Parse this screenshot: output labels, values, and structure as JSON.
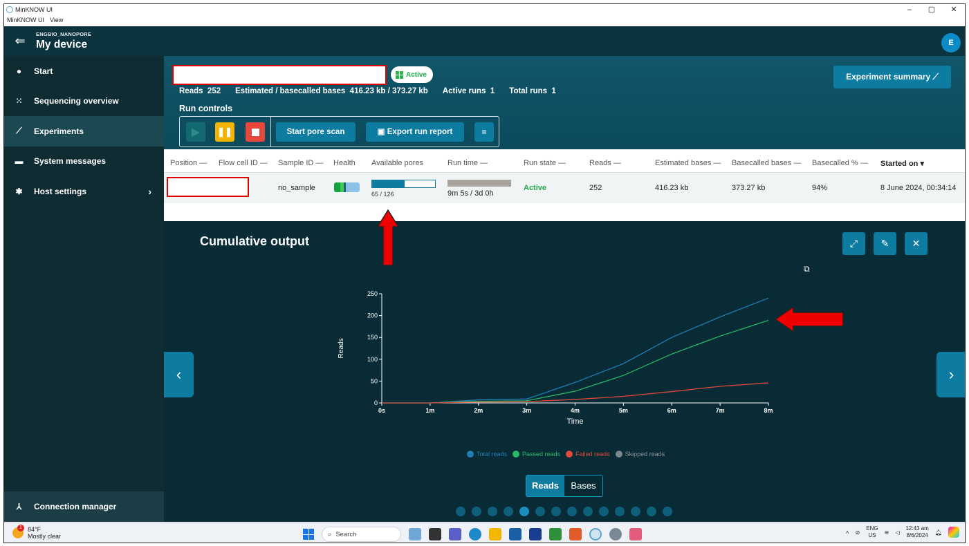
{
  "window": {
    "title": "MinKNOW UI",
    "menu": [
      "MinKNOW UI",
      "View"
    ],
    "controls": [
      "–",
      "▢",
      "✕"
    ]
  },
  "device": {
    "org": "ENGBIO_NANOPORE",
    "name": "My device",
    "avatar_initial": "E"
  },
  "sidebar": {
    "items": [
      {
        "label": "Start",
        "icon": "play-circle-icon"
      },
      {
        "label": "Sequencing overview",
        "icon": "grid-icon"
      },
      {
        "label": "Experiments",
        "icon": "trend-icon",
        "active": true
      },
      {
        "label": "System messages",
        "icon": "message-icon"
      },
      {
        "label": "Host settings",
        "icon": "gear-icon",
        "chevron": "›"
      }
    ],
    "connection_manager": "Connection manager"
  },
  "header": {
    "status": "Active",
    "stats": {
      "reads_label": "Reads",
      "reads_value": "252",
      "bases_label": "Estimated / basecalled bases",
      "bases_value": "416.23 kb / 373.27 kb",
      "active_runs_label": "Active runs",
      "active_runs_value": "1",
      "total_runs_label": "Total runs",
      "total_runs_value": "1"
    },
    "run_controls_label": "Run controls",
    "start_pore_scan": "Start pore scan",
    "export_run_report": "Export run report",
    "experiment_summary": "Experiment summary"
  },
  "table": {
    "columns": [
      "Position —",
      "Flow cell ID —",
      "Sample ID —",
      "Health",
      "Available pores",
      "Run time —",
      "Run state —",
      "Reads —",
      "Estimated bases —",
      "Basecalled bases —",
      "Basecalled % —",
      "Started on ▾"
    ],
    "row": {
      "sample_id": "no_sample",
      "pores_label": "65 / 126",
      "pores_fraction": 0.52,
      "run_time": "9m 5s / 3d 0h",
      "run_state": "Active",
      "reads": "252",
      "estimated_bases": "416.23 kb",
      "basecalled_bases": "373.27 kb",
      "basecalled_pct": "94%",
      "started_on": "8 June 2024, 00:34:14"
    }
  },
  "chart_panel": {
    "title": "Cumulative output",
    "toggle": {
      "on": "Reads",
      "off": "Bases"
    },
    "pages": 14,
    "current_page": 5
  },
  "chart_data": {
    "type": "line",
    "title": "Cumulative output",
    "xlabel": "Time",
    "ylabel": "Reads",
    "x": [
      0,
      1,
      2,
      3,
      4,
      5,
      6,
      7,
      8
    ],
    "x_tick_labels": [
      "0s",
      "1m",
      "2m",
      "3m",
      "4m",
      "5m",
      "6m",
      "7m",
      "8m"
    ],
    "y_ticks": [
      0,
      50,
      100,
      150,
      200,
      250
    ],
    "ylim": [
      0,
      250
    ],
    "series": [
      {
        "name": "Total reads",
        "color": "#1f7fb4",
        "values": [
          0,
          0,
          7,
          9,
          47,
          90,
          150,
          197,
          240
        ]
      },
      {
        "name": "Passed reads",
        "color": "#27b868",
        "values": [
          0,
          0,
          4,
          5,
          27,
          63,
          112,
          153,
          189
        ]
      },
      {
        "name": "Failed reads",
        "color": "#e0483a",
        "values": [
          0,
          0,
          2,
          3,
          8,
          15,
          26,
          38,
          46
        ]
      },
      {
        "name": "Skipped reads",
        "color": "#7a868a",
        "values": []
      }
    ],
    "grid": false,
    "legend": "bottom"
  },
  "taskbar": {
    "weather_temp": "84°F",
    "weather_desc": "Mostly clear",
    "weather_badge": "1",
    "search_placeholder": "Search",
    "lang": "ENG",
    "region": "US",
    "time": "12:43 am",
    "date": "8/6/2024"
  }
}
